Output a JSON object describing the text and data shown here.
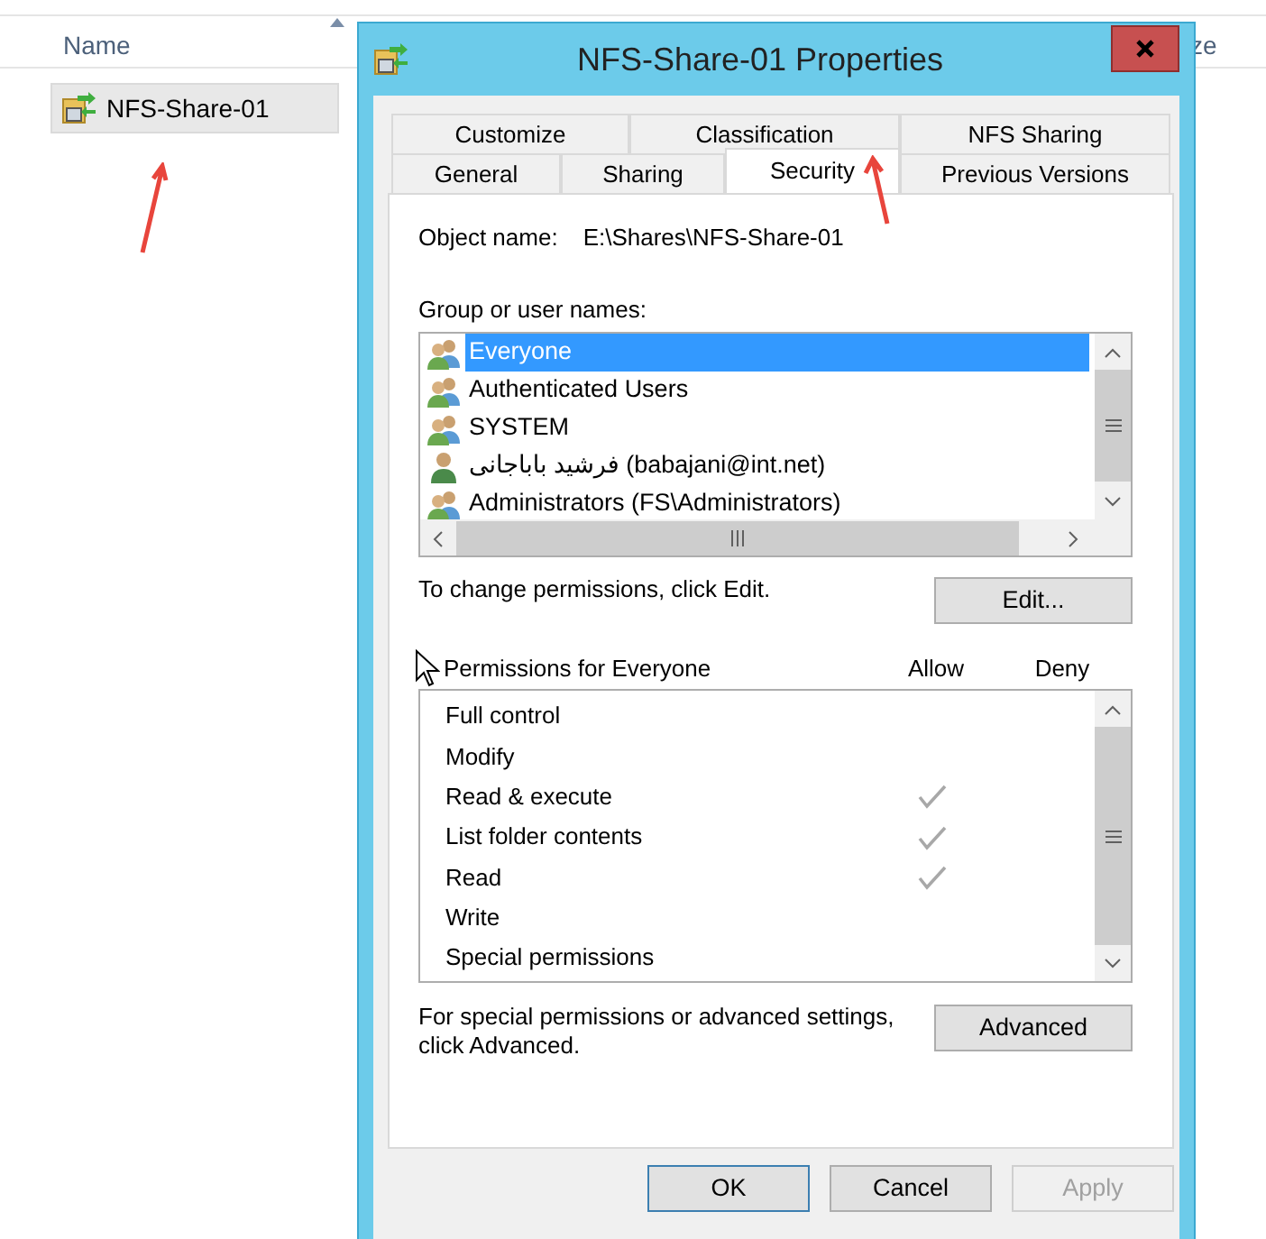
{
  "explorer": {
    "columns": [
      {
        "label": "Name",
        "sorted": true
      },
      {
        "label": "ze",
        "sorted": false
      }
    ],
    "items": [
      {
        "name": "NFS-Share-01",
        "selected": true
      }
    ]
  },
  "dialog": {
    "title": "NFS-Share-01 Properties",
    "tab_rows": [
      [
        {
          "label": "Customize",
          "selected": false
        },
        {
          "label": "Classification",
          "selected": false
        },
        {
          "label": "NFS Sharing",
          "selected": false
        }
      ],
      [
        {
          "label": "General",
          "selected": false
        },
        {
          "label": "Sharing",
          "selected": false
        },
        {
          "label": "Security",
          "selected": true
        },
        {
          "label": "Previous Versions",
          "selected": false
        }
      ]
    ],
    "object_name": {
      "label": "Object name:",
      "value": "E:\\Shares\\NFS-Share-01"
    },
    "group_label": "Group or user names:",
    "users": [
      {
        "name": "Everyone",
        "kind": "group",
        "selected": true
      },
      {
        "name": "Authenticated Users",
        "kind": "group",
        "selected": false
      },
      {
        "name": "SYSTEM",
        "kind": "group",
        "selected": false
      },
      {
        "name": "فرشید باباجانی (babajani@int.net)",
        "kind": "user",
        "selected": false
      },
      {
        "name": "Administrators (FS\\Administrators)",
        "kind": "group",
        "selected": false
      }
    ],
    "change_hint": "To change permissions, click Edit.",
    "edit_button": "Edit...",
    "permissions_label": "Permissions for Everyone",
    "permission_columns": [
      "Allow",
      "Deny"
    ],
    "permissions": [
      {
        "name": "Full control",
        "allow": false,
        "deny": false
      },
      {
        "name": "Modify",
        "allow": false,
        "deny": false
      },
      {
        "name": "Read & execute",
        "allow": true,
        "deny": false
      },
      {
        "name": "List folder contents",
        "allow": true,
        "deny": false
      },
      {
        "name": "Read",
        "allow": true,
        "deny": false
      },
      {
        "name": "Write",
        "allow": false,
        "deny": false
      },
      {
        "name": "Special permissions",
        "allow": false,
        "deny": false
      }
    ],
    "advanced_hint": "For special permissions or advanced settings, click Advanced.",
    "advanced_button": "Advanced",
    "buttons": [
      {
        "label": "OK",
        "disabled": false,
        "default": true
      },
      {
        "label": "Cancel",
        "disabled": false,
        "default": false
      },
      {
        "label": "Apply",
        "disabled": true,
        "default": false
      }
    ]
  }
}
